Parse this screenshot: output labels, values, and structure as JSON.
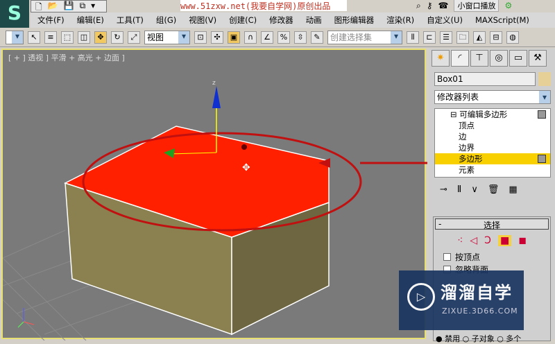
{
  "app": {
    "logo": "S",
    "title_banner": "www.51zxw.net(我要自学网)原创出品",
    "mini_play": "小窗口播放"
  },
  "quick_access": [
    "🗋",
    "📂",
    "💾",
    "⧉",
    "▾"
  ],
  "menu": [
    "文件(F)",
    "编辑(E)",
    "工具(T)",
    "组(G)",
    "视图(V)",
    "创建(C)",
    "修改器",
    "动画",
    "图形编辑器",
    "渲染(R)",
    "自定义(U)",
    "MAXScript(M)"
  ],
  "toolbar": {
    "view_select": "视图",
    "selection_set_placeholder": "创建选择集"
  },
  "viewport": {
    "label": "[ + ] 透视 ] 平滑 + 高光 + 边面 ]",
    "axis_z": "z"
  },
  "panel": {
    "object_name": "Box01",
    "modifier_list": "修改器列表",
    "stack": [
      {
        "label": "可编辑多边形",
        "top": true
      },
      {
        "label": "顶点"
      },
      {
        "label": "边"
      },
      {
        "label": "边界"
      },
      {
        "label": "多边形",
        "selected": true
      },
      {
        "label": "元素"
      }
    ],
    "rollout_title": "选择",
    "rollout_collapse": "-",
    "checkboxes": [
      "按顶点",
      "忽略背面"
    ],
    "radios": [
      "禁用",
      "子对象",
      "多个"
    ]
  },
  "watermark": {
    "title": "溜溜自学",
    "url": "ZIXUE.3D66.COM"
  },
  "colors": {
    "selected_face": "#ff2000",
    "box_side": "#8a8050",
    "highlight": "#f8d000",
    "annotation": "#c01010"
  }
}
